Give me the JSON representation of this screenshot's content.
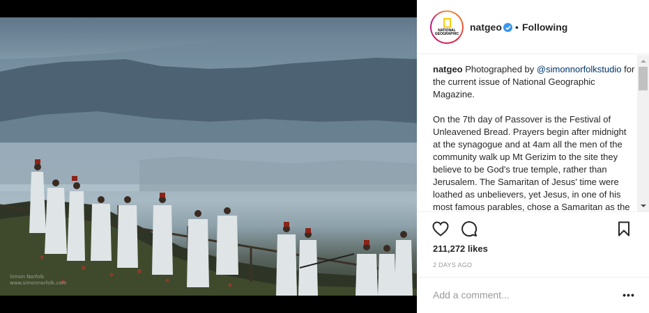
{
  "post": {
    "author": "natgeo",
    "avatar_lines": [
      "NATIONAL",
      "GEOGRAPHIC"
    ],
    "follow_separator": "•",
    "follow_label": "Following",
    "photo_credit_lines": [
      "Simon Norfolk",
      "www.simonnorfolk.com"
    ],
    "caption": {
      "user": "natgeo",
      "intro": "Photographed by",
      "mention": "@simonnorfolkstudio",
      "intro_rest": "for the current issue of National Geographic Magazine.",
      "body": "On the 7th day of Passover is the Festival of Unleavened Bread. Prayers begin after midnight at the synagogue and at 4am all the men of the community walk up Mt Gerizim to the site they believe to be God's true temple, rather than Jerusalem. The Samaritan of Jesus' time were loathed as unbelievers, yet Jesus, in one of his most famous parables, chose a Samaritan as the hero of the story."
    },
    "likes": "211,272 likes",
    "time_ago": "2 DAYS AGO",
    "comment_placeholder": "Add a comment...",
    "more_label": "•••"
  },
  "icons": {
    "verified": "verified-badge-icon",
    "like": "heart-icon",
    "comment": "comment-bubble-icon",
    "save": "bookmark-icon",
    "more": "more-options-icon"
  },
  "colors": {
    "verified": "#3897f0",
    "mention": "#003569",
    "muted": "#999999",
    "ng_yellow": "#ffcc00"
  }
}
